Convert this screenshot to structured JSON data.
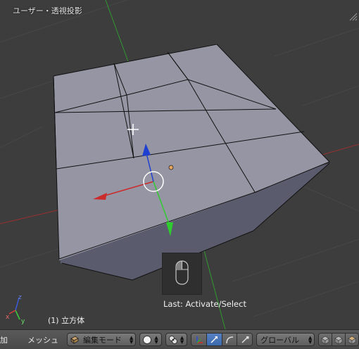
{
  "viewport": {
    "title": "ユーザー・透視投影",
    "object_name": "(1) 立方体",
    "last_operator": "Last: Activate/Select",
    "axis_labels": {
      "z": "z",
      "y": "y",
      "x": "x"
    }
  },
  "header": {
    "menus": [
      "加",
      "メッシュ"
    ],
    "mode_select": "編集モード",
    "orientation_select": "グローバル"
  },
  "colors": {
    "background": "#3d3d3d",
    "face": "#9595a4",
    "face_dark": "#5b5b6e",
    "axis_x": "#cc2b2b",
    "axis_y": "#2fcc2f",
    "axis_z": "#1f3fd0",
    "header": "#4f4f4f",
    "active_button": "#4a75b8"
  },
  "icons": {
    "mode_icon": "edit-mode-icon",
    "shading_icon": "solid-shading-icon",
    "pivot_icon": "pivot-icon",
    "manipulator_icon": "manipulator-icon",
    "translate_icon": "translate-icon",
    "rotate_icon": "rotate-icon",
    "scale_icon": "scale-icon",
    "mouse_icon": "mouse-icon",
    "cursor_icon": "3d-cursor-icon"
  }
}
